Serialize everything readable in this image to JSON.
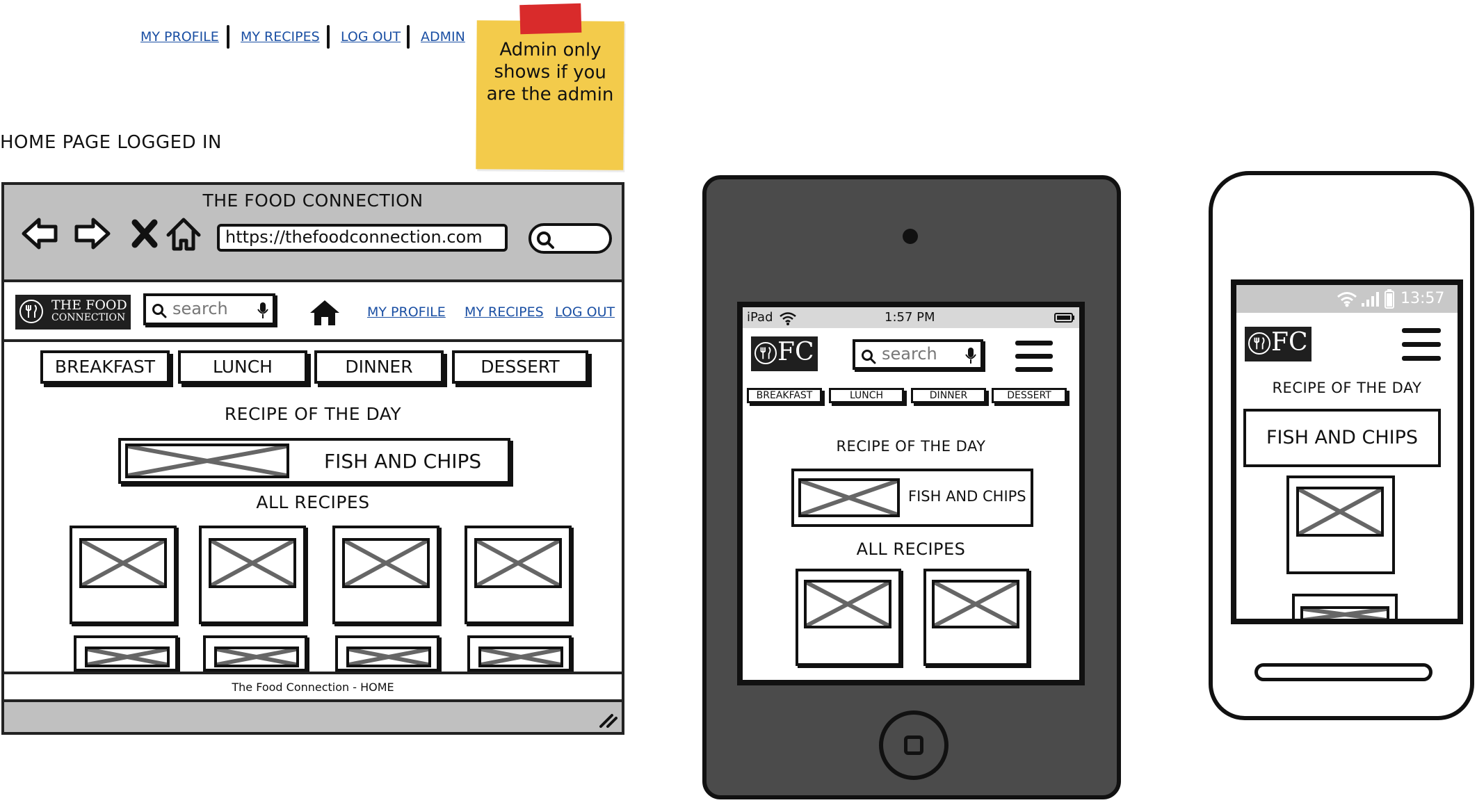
{
  "annotation": {
    "nav_links": [
      "MY PROFILE",
      "MY RECIPES",
      "LOG OUT",
      "ADMIN"
    ],
    "page_label": "HOME PAGE LOGGED IN",
    "sticky_note": "Admin only shows if you are the admin"
  },
  "desktop": {
    "window_title": "THE FOOD CONNECTION",
    "url": "https://thefoodconnection.com",
    "logo_line1": "THE FOOD",
    "logo_line2": "CONNECTION",
    "search_placeholder": "search",
    "header_links": [
      "MY PROFILE",
      "MY RECIPES",
      "LOG OUT"
    ],
    "categories": [
      "BREAKFAST",
      "LUNCH",
      "DINNER",
      "DESSERT"
    ],
    "recipe_of_day_title": "RECIPE OF THE DAY",
    "featured_recipe": "FISH AND CHIPS",
    "all_recipes_title": "ALL RECIPES",
    "footer": "The Food Connection  - HOME"
  },
  "tablet": {
    "device": "iPad",
    "time": "1:57 PM",
    "logo": "FC",
    "search_placeholder": "search",
    "categories": [
      "BREAKFAST",
      "LUNCH",
      "DINNER",
      "DESSERT"
    ],
    "recipe_of_day_title": "RECIPE OF THE DAY",
    "featured_recipe": "FISH AND CHIPS",
    "all_recipes_title": "ALL RECIPES"
  },
  "phone": {
    "time": "13:57",
    "logo": "FC",
    "recipe_of_day_title": "RECIPE OF THE DAY",
    "featured_recipe": "FISH AND CHIPS"
  },
  "colors": {
    "sticky": "#f3cb4b",
    "tape": "#d92b2b",
    "browser_chrome": "#c0c0c0",
    "ipad_body": "#4b4b4b",
    "link": "#1a4fa3"
  }
}
